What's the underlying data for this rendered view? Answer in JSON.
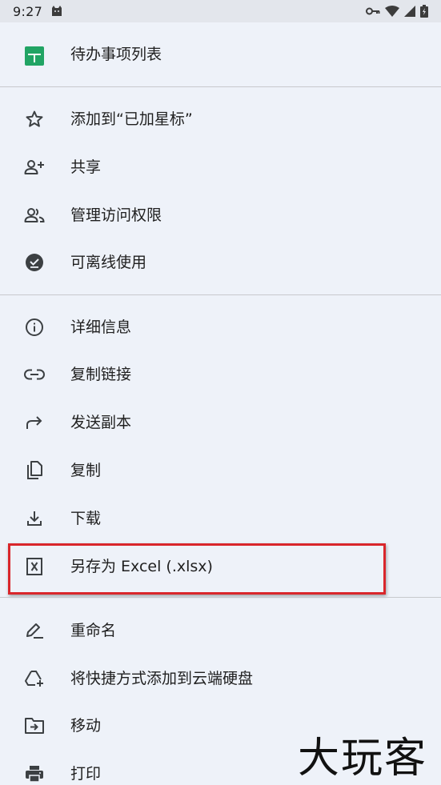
{
  "status": {
    "time": "9:27"
  },
  "header": {
    "title": "待办事项列表"
  },
  "menu": {
    "star": "添加到“已加星标”",
    "share": "共享",
    "manage": "管理访问权限",
    "offline": "可离线使用",
    "details": "详细信息",
    "copy_link": "复制链接",
    "send_copy": "发送副本",
    "duplicate": "复制",
    "download": "下载",
    "save_excel": "另存为 Excel (.xlsx)",
    "rename": "重命名",
    "add_shortcut": "将快捷方式添加到云端硬盘",
    "move": "移动",
    "print": "打印"
  },
  "watermark": "大玩客",
  "colors": {
    "sheets_green": "#21a464",
    "highlight": "#d9262b"
  }
}
